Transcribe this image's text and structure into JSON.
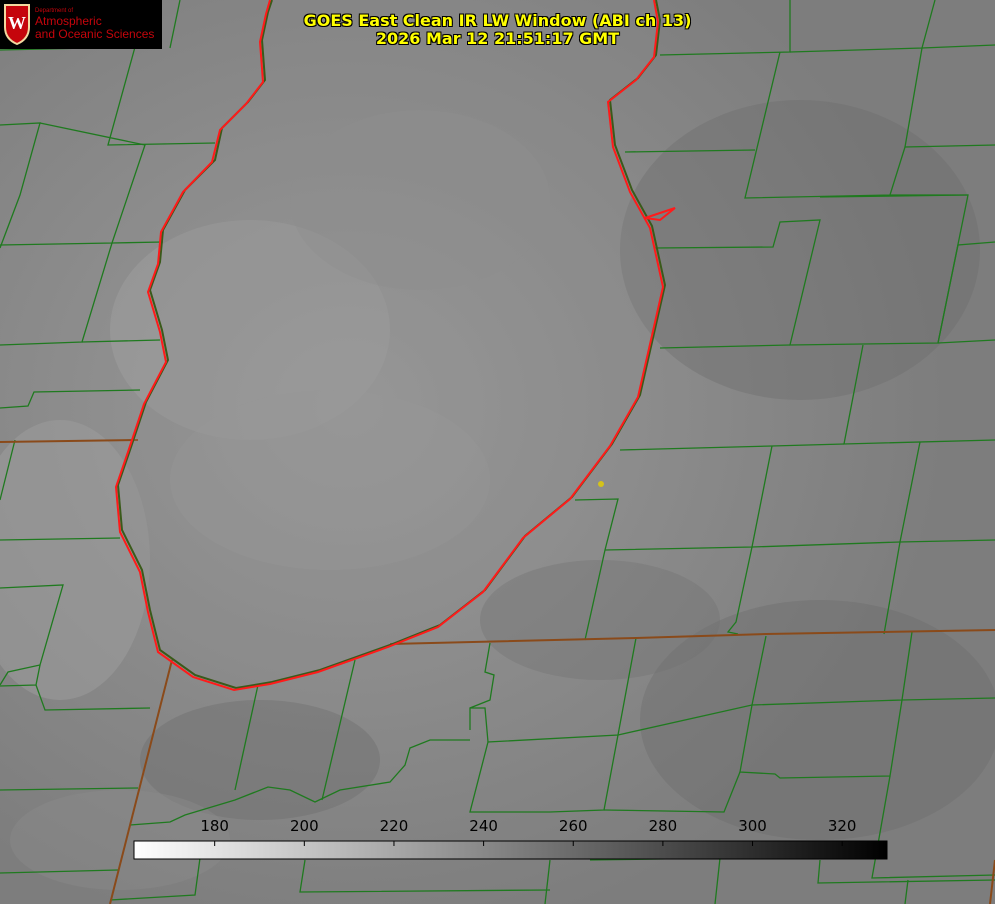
{
  "title": {
    "line1": "GOES East Clean IR LW Window (ABI ch 13)",
    "line2": "2026 Mar 12 21:51:17 GMT"
  },
  "logo": {
    "icon": "wisconsin-crest-icon",
    "crest_letter": "W",
    "department": "Department of",
    "line1": "Atmospheric",
    "line2": "and Oceanic Sciences"
  },
  "colorbar": {
    "ticks": [
      180,
      200,
      220,
      240,
      260,
      280,
      300,
      320
    ],
    "range": [
      162,
      330
    ],
    "colors": {
      "low": "#ffffff",
      "high": "#000000"
    }
  },
  "map_colors": {
    "lake_outline": "#ff1a1a",
    "county_lines": "#1f7a1f",
    "state_lines": "#8a4a1a",
    "marker": "#d4c21a"
  }
}
